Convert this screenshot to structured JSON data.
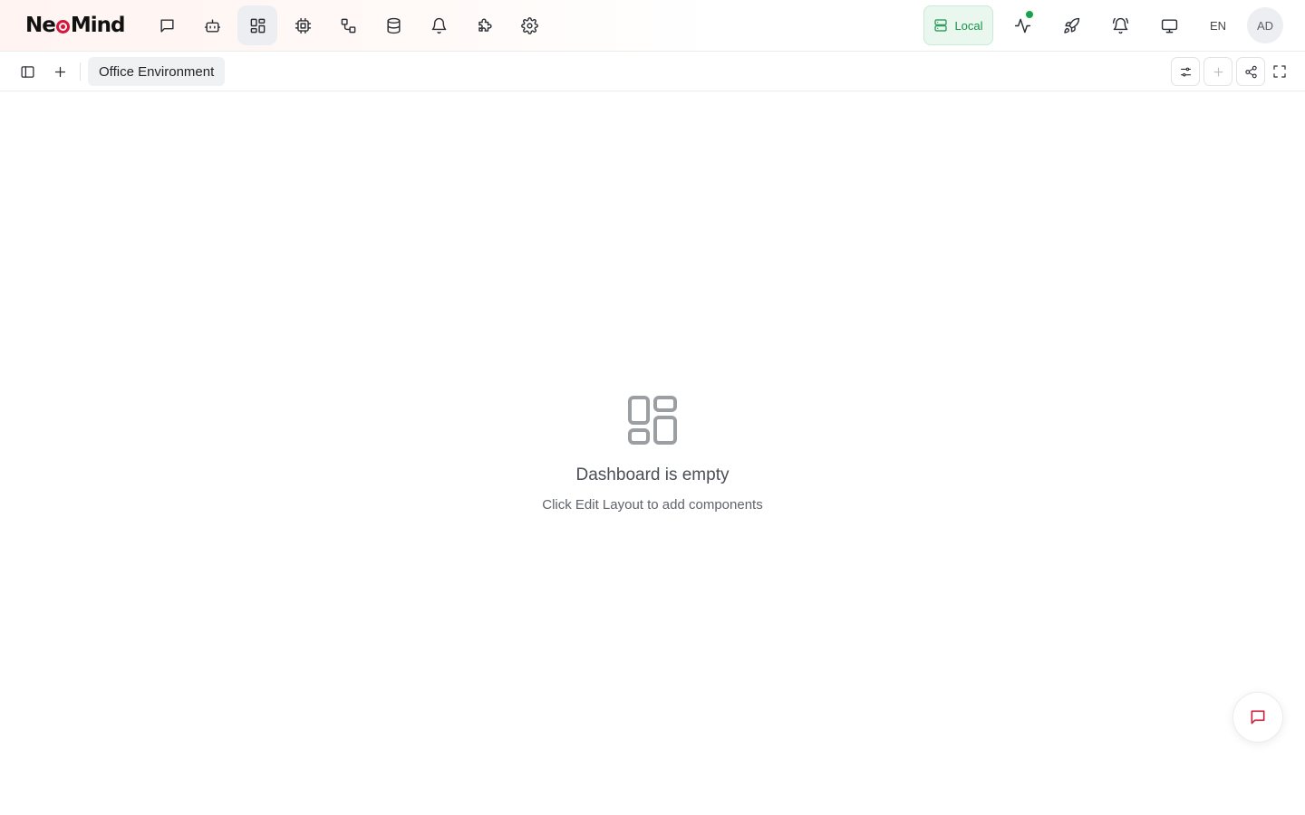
{
  "header": {
    "logo": {
      "prefix": "Ne",
      "suffix": "Mind",
      "accent_color": "#d4183d"
    },
    "nav": [
      {
        "icon": "chat-icon",
        "active": false
      },
      {
        "icon": "robot-icon",
        "active": false
      },
      {
        "icon": "dashboard-icon",
        "active": true
      },
      {
        "icon": "chip-icon",
        "active": false
      },
      {
        "icon": "workflow-icon",
        "active": false
      },
      {
        "icon": "database-icon",
        "active": false
      },
      {
        "icon": "bell-icon",
        "active": false
      },
      {
        "icon": "puzzle-icon",
        "active": false
      },
      {
        "icon": "gear-icon",
        "active": false
      }
    ],
    "connection": {
      "label": "Local",
      "color": "#17924a"
    },
    "status_dot_color": "#16a34a",
    "language": "EN",
    "avatar_initials": "AD"
  },
  "toolbar": {
    "active_tab": "Office Environment"
  },
  "empty_state": {
    "title": "Dashboard is empty",
    "subtitle": "Click Edit Layout to add components"
  }
}
